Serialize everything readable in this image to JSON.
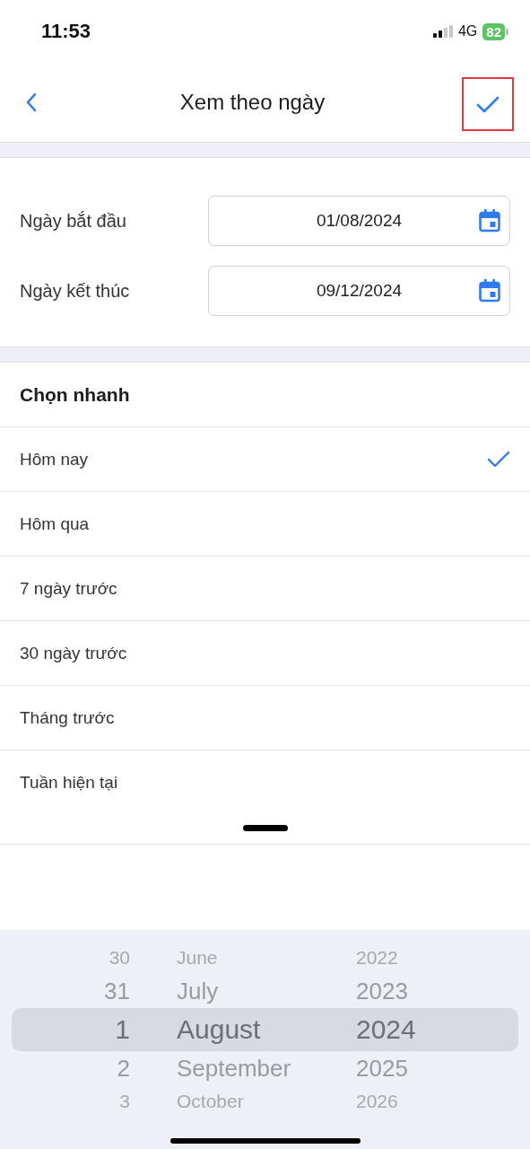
{
  "status_bar": {
    "time": "11:53",
    "network": "4G",
    "battery": "82"
  },
  "nav": {
    "title": "Xem theo ngày",
    "confirm_highlighted": true
  },
  "date_fields": [
    {
      "label": "Ngày bắt đầu",
      "value": "01/08/2024"
    },
    {
      "label": "Ngày kết thúc",
      "value": "09/12/2024"
    }
  ],
  "quick_pick": {
    "title": "Chọn nhanh",
    "items": [
      {
        "label": "Hôm nay",
        "selected": true
      },
      {
        "label": "Hôm qua",
        "selected": false
      },
      {
        "label": "7 ngày trước",
        "selected": false
      },
      {
        "label": "30 ngày trước",
        "selected": false
      },
      {
        "label": "Tháng trước",
        "selected": false
      },
      {
        "label": "Tuần hiện tại",
        "selected": false
      }
    ]
  },
  "picker": {
    "columns": [
      {
        "kind": "day",
        "items": [
          {
            "text": "30",
            "selected": false
          },
          {
            "text": "31",
            "selected": false
          },
          {
            "text": "1",
            "selected": true
          },
          {
            "text": "2",
            "selected": false
          },
          {
            "text": "3",
            "selected": false
          }
        ]
      },
      {
        "kind": "month",
        "items": [
          {
            "text": "June",
            "selected": false
          },
          {
            "text": "July",
            "selected": false
          },
          {
            "text": "August",
            "selected": true
          },
          {
            "text": "September",
            "selected": false
          },
          {
            "text": "October",
            "selected": false
          }
        ]
      },
      {
        "kind": "year",
        "items": [
          {
            "text": "2022",
            "selected": false
          },
          {
            "text": "2023",
            "selected": false
          },
          {
            "text": "2024",
            "selected": true
          },
          {
            "text": "2025",
            "selected": false
          },
          {
            "text": "2026",
            "selected": false
          }
        ]
      }
    ]
  }
}
